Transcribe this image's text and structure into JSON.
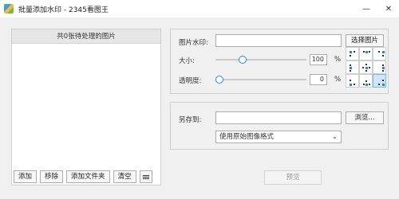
{
  "window": {
    "title": "批量添加水印 - 2345看图王",
    "minimize_glyph": "—",
    "close_glyph": "✕"
  },
  "file_list": {
    "header": "共0张待处理的图片",
    "buttons": {
      "add": "添加",
      "remove": "移除",
      "add_folder": "添加文件夹",
      "clear": "清空"
    }
  },
  "watermark": {
    "image_label": "图片水印:",
    "image_value": "",
    "choose_image_button": "选择图片",
    "size_label": "大小:",
    "size_value": "100",
    "size_percent": 1.0,
    "opacity_label": "透明度:",
    "opacity_value": "0",
    "opacity_percent": 0.0,
    "percent_unit": "%",
    "position_selected": "bottom-right"
  },
  "save": {
    "save_to_label": "另存到:",
    "save_to_value": "",
    "browse_button": "浏览...",
    "format_selected": "使用原始图像格式"
  },
  "actions": {
    "preview_button": "预览"
  }
}
